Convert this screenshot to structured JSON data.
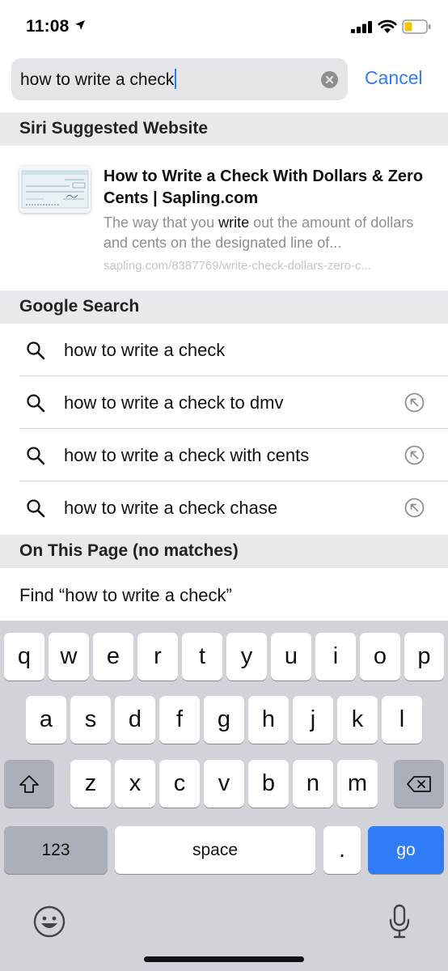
{
  "status_bar": {
    "time": "11:08"
  },
  "search": {
    "query": "how to write a check",
    "cancel_label": "Cancel"
  },
  "sections": {
    "siri_header": "Siri Suggested Website",
    "google_header": "Google Search",
    "on_page_header": "On This Page (no matches)"
  },
  "siri_suggestion": {
    "title": "How to Write a Check With Dollars & Zero Cents | Sapling.com",
    "snippet_before": "The way that you ",
    "snippet_highlight": "write",
    "snippet_after": " out the amount of dollars and cents on the designated line of...",
    "url": "sapling.com/8387769/write-check-dollars-zero-c..."
  },
  "google_suggestions": [
    {
      "label": "how to write a check"
    },
    {
      "label": "how to write a check to dmv"
    },
    {
      "label": "how to write a check with cents"
    },
    {
      "label": "how to write a check chase"
    }
  ],
  "find_on_page": {
    "label": "Find “how to write a check”"
  },
  "keyboard": {
    "row1": [
      "q",
      "w",
      "e",
      "r",
      "t",
      "y",
      "u",
      "i",
      "o",
      "p"
    ],
    "row2": [
      "a",
      "s",
      "d",
      "f",
      "g",
      "h",
      "j",
      "k",
      "l"
    ],
    "row3": [
      "z",
      "x",
      "c",
      "v",
      "b",
      "n",
      "m"
    ],
    "numbers_label": "123",
    "space_label": "space",
    "period_label": ".",
    "go_label": "go"
  },
  "colors": {
    "accent": "#2f7cf6",
    "section_bg": "#e8e8ed",
    "keyboard_bg": "#d1d3d9"
  }
}
